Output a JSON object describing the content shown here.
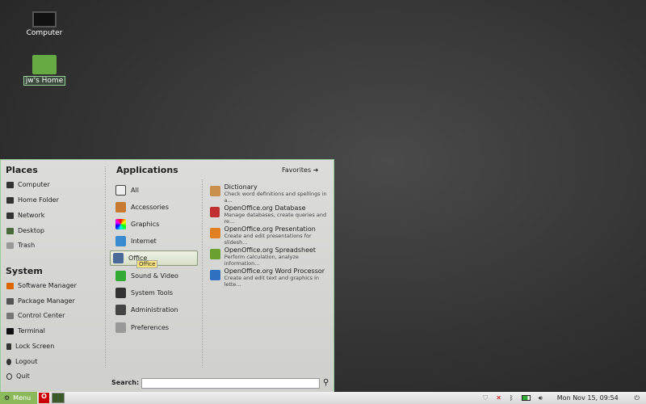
{
  "desktop": {
    "icons": [
      {
        "label": "Computer"
      },
      {
        "label": "jw's Home"
      }
    ]
  },
  "menu": {
    "places_title": "Places",
    "places": [
      "Computer",
      "Home Folder",
      "Network",
      "Desktop",
      "Trash"
    ],
    "system_title": "System",
    "system": [
      "Software Manager",
      "Package Manager",
      "Control Center",
      "Terminal",
      "Lock Screen",
      "Logout",
      "Quit"
    ],
    "applications_title": "Applications",
    "favorites_label": "Favorites",
    "categories": [
      "All",
      "Accessories",
      "Graphics",
      "Internet",
      "Office",
      "Sound & Video",
      "System Tools",
      "Administration",
      "Preferences"
    ],
    "tooltip": "Office",
    "apps": [
      {
        "name": "Dictionary",
        "desc": "Check word definitions and spellings in a...",
        "color": "#c8904a"
      },
      {
        "name": "OpenOffice.org Database",
        "desc": "Manage databases, create queries and re...",
        "color": "#c03030"
      },
      {
        "name": "OpenOffice.org Presentation",
        "desc": "Create and edit presentations for slidesh...",
        "color": "#e08020"
      },
      {
        "name": "OpenOffice.org Spreadsheet",
        "desc": "Perform calculation, analyze information...",
        "color": "#6aa030"
      },
      {
        "name": "OpenOffice.org Word Processor",
        "desc": "Create and edit text and graphics in lette...",
        "color": "#3070c0"
      }
    ],
    "search_label": "Search:",
    "search_value": ""
  },
  "taskbar": {
    "menu_label": "Menu",
    "clock": "Mon Nov 15, 09:54"
  }
}
